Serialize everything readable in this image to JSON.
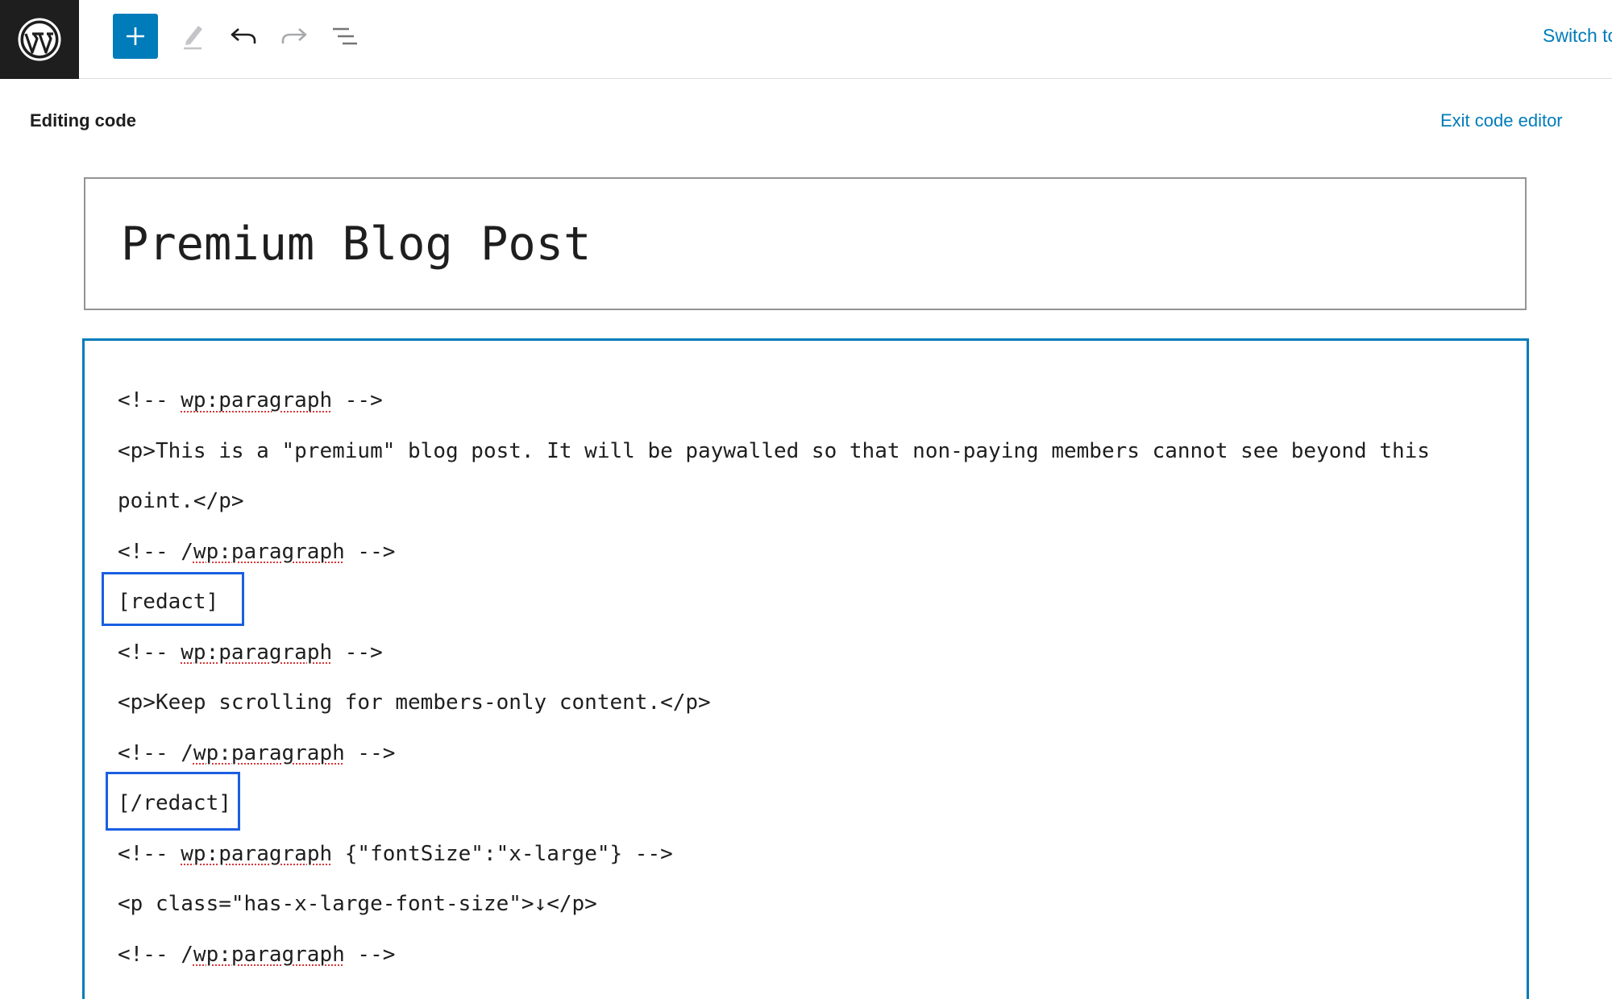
{
  "toolbar": {
    "switch_label": "Switch to draft"
  },
  "header": {
    "editing_label": "Editing code",
    "exit_label": "Exit code editor"
  },
  "post": {
    "title": "Premium Blog Post"
  },
  "code": {
    "lines": [
      {
        "pre": "<!-- ",
        "spell": "wp:paragraph",
        "post": " -->"
      },
      {
        "pre": "<p>This is a \"premium\" blog post. It will be paywalled so that non-paying members cannot see beyond this",
        "spell": "",
        "post": ""
      },
      {
        "pre": "point.</p>",
        "spell": "",
        "post": ""
      },
      {
        "pre": "<!-- /",
        "spell": "wp:paragraph",
        "post": " -->"
      },
      {
        "pre": "[redact]",
        "spell": "",
        "post": ""
      },
      {
        "pre": "<!-- ",
        "spell": "wp:paragraph",
        "post": " -->"
      },
      {
        "pre": "<p>Keep scrolling for members-only content.</p>",
        "spell": "",
        "post": ""
      },
      {
        "pre": "<!-- /",
        "spell": "wp:paragraph",
        "post": " -->"
      },
      {
        "pre": "[/redact]",
        "spell": "",
        "post": ""
      },
      {
        "pre": "<!-- ",
        "spell": "wp:paragraph",
        "post": " {\"fontSize\":\"x-large\"} -->"
      },
      {
        "pre": "<p class=\"has-x-large-font-size\">↓</p>",
        "spell": "",
        "post": ""
      },
      {
        "pre": "<!-- /",
        "spell": "wp:paragraph",
        "post": " -->"
      }
    ]
  },
  "colors": {
    "accent": "#007cba",
    "highlight": "#1a5fe0",
    "logo_bg": "#1e1e1e"
  }
}
